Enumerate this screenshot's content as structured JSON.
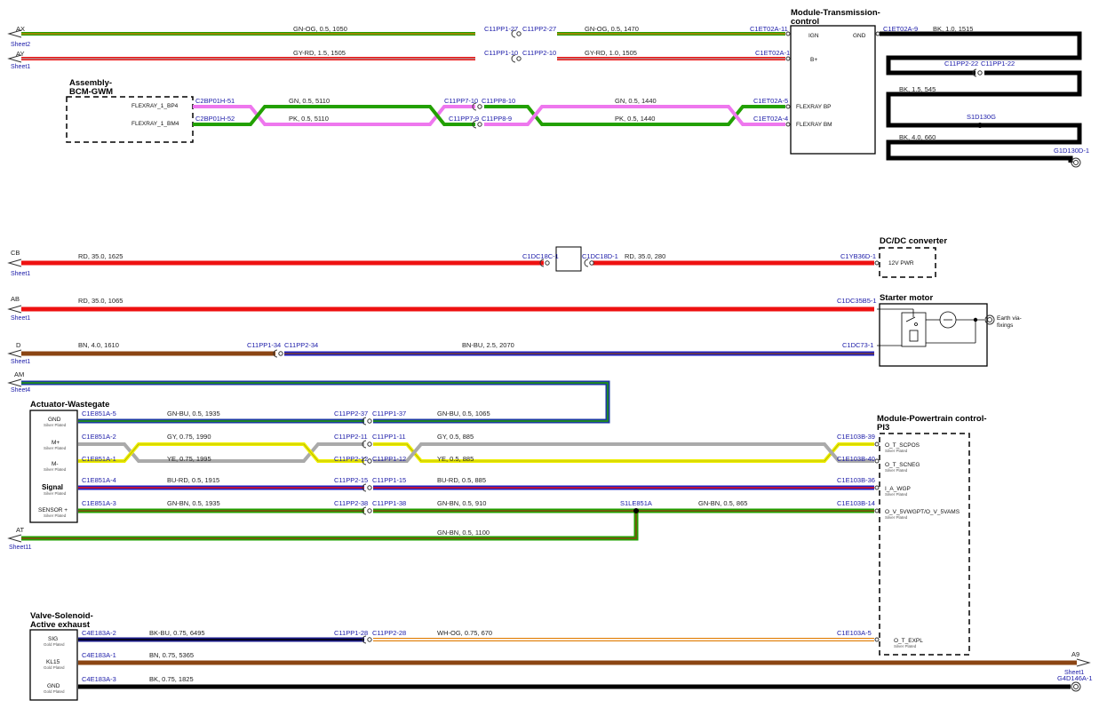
{
  "colors": {
    "gn": "#22a000",
    "og": "#e07a00",
    "rd": "#ee1111",
    "gy": "#aaaaaa",
    "pk": "#ee77ee",
    "bk": "#000000",
    "bn": "#8b4513",
    "bu": "#2020c0",
    "ye": "#eeee00",
    "wh": "#ffffff",
    "dk": "#111111",
    "conn_text": "#1a1aa8"
  },
  "top": {
    "ax": {
      "code": "AX",
      "sheet": "Sheet2",
      "w1": "GN-OG, 0.5, 1050",
      "c1": "C11PP1-27",
      "c2": "C11PP2-27",
      "w2": "GN-OG, 0.5, 1470",
      "c3": "C1ET02A-11"
    },
    "ay": {
      "code": "AY",
      "sheet": "Sheet1",
      "w1": "GY-RD, 1.5, 1505",
      "c1": "C11PP1-10",
      "c2": "C11PP2-10",
      "w2": "GY-RD, 1.0, 1505",
      "c3": "C1ET02A-1"
    },
    "bcm": {
      "title1": "Assembly-",
      "title2": "BCM-GWM",
      "pin1": "FLEXRAY_1_BP4",
      "pin2": "FLEXRAY_1_BM4",
      "c1": "C2BP01H-51",
      "c2": "C2BP01H-52"
    },
    "fr": {
      "w1": "GN, 0.5, 5110",
      "w2": "PK, 0.5, 5110",
      "c3": "C11PP7-10",
      "c4": "C11PP8-10",
      "c5": "C11PP7-9",
      "c6": "C11PP8-9",
      "w3": "GN, 0.5, 1440",
      "w4": "PK, 0.5, 1440",
      "c7": "C1ET02A-5",
      "c8": "C1ET02A-4"
    },
    "tcm": {
      "title1": "Module-Transmission-",
      "title2": "control",
      "ign": "IGN",
      "gnd": "GND",
      "bplus": "B+",
      "frbp": "FLEXRAY BP",
      "frbm": "FLEXRAY BM"
    },
    "gnd": {
      "c1": "C1ET02A-9",
      "w1": "BK, 1.0, 1515",
      "c2": "C11PP2-22",
      "c3": "C11PP1-22",
      "w2": "BK, 1.5, 545",
      "splice": "S1D130G",
      "w3": "BK, 4.0, 660",
      "ground": "G1D130D-1"
    }
  },
  "power": {
    "cb": {
      "code": "CB",
      "sheet": "Sheet1",
      "w1": "RD, 35.0, 1625",
      "c1": "C1DC18C-1",
      "c2": "C1DC18D-1",
      "w2": "RD, 35.0, 280",
      "c3": "C1YB36D-1"
    },
    "dcdc": {
      "title": "DC/DC converter",
      "pin": "12V PWR"
    },
    "ab": {
      "code": "AB",
      "sheet": "Sheet1",
      "w1": "RD, 35.0, 1065",
      "c1": "C1DC35B5-1"
    },
    "starter": {
      "title": "Starter motor",
      "earth1": "Earth via-",
      "earth2": "fixings"
    },
    "d": {
      "code": "D",
      "sheet": "Sheet1",
      "w1": "BN, 4.0, 1610",
      "c1": "C11PP1-34",
      "c2": "C11PP2-34",
      "w2": "BN-BU, 2.5, 2070",
      "c3": "C1DC73-1"
    }
  },
  "wastegate": {
    "am": {
      "code": "AM",
      "sheet": "Sheet4"
    },
    "title": "Actuator-Wastegate",
    "plating": "Silver Plated",
    "pins": [
      "GND",
      "M+",
      "M-",
      "Signal",
      "SENSOR +"
    ],
    "rows": [
      {
        "ca": "C1E851A-5",
        "w1": "GN-BU, 0.5, 1935",
        "cb": "C11PP2-37",
        "cc": "C11PP1-37",
        "w2": "GN-BU, 0.5, 1065"
      },
      {
        "ca": "C1E851A-2",
        "w1": "GY, 0.75, 1990",
        "cb": "C11PP2-11",
        "cc": "C11PP1-11",
        "w2": "GY, 0.5, 885",
        "cd": "C1E103B-39"
      },
      {
        "ca": "C1E851A-1",
        "w1": "YE, 0.75, 1995",
        "cb": "C11PP2-12",
        "cc": "C11PP1-12",
        "w2": "YE, 0.5, 885",
        "cd": "C1E103B-40"
      },
      {
        "ca": "C1E851A-4",
        "w1": "BU-RD, 0.5, 1915",
        "cb": "C11PP2-15",
        "cc": "C11PP1-15",
        "w2": "BU-RD, 0.5, 885",
        "cd": "C1E103B-36"
      },
      {
        "ca": "C1E851A-3",
        "w1": "GN-BN, 0.5, 1935",
        "cb": "C11PP2-38",
        "cc": "C11PP1-38",
        "w2": "GN-BN, 0.5, 910",
        "splice": "S1LE851A",
        "w3": "GN-BN, 0.5, 865",
        "cd": "C1E103B-14"
      }
    ],
    "at": {
      "code": "AT",
      "sheet": "Sheet11",
      "w1": "GN-BN, 0.5, 1100"
    }
  },
  "pcm": {
    "title1": "Module-Powertrain control-",
    "title2": "PI3",
    "plating": "Silver Plated",
    "pins": [
      "O_T_SCPOS",
      "O_T_SCNEG",
      "I_A_WGP",
      "O_V_5VWGPT/O_V_5VAMS",
      "O_T_EXPL"
    ]
  },
  "valve": {
    "title1": "Valve-Solenoid-",
    "title2": "Active exhaust",
    "plating": "Gold Plated",
    "pins": [
      "SIG",
      "KL15",
      "GND"
    ],
    "rows": [
      {
        "ca": "C4E183A-2",
        "w1": "BK-BU, 0.75, 6495",
        "cb": "C11PP1-28",
        "cc": "C11PP2-28",
        "w2": "WH-OG, 0.75, 670",
        "cd": "C1E103A-5"
      },
      {
        "ca": "C4E183A-1",
        "w1": "BN, 0.75, 5365",
        "code": "A9",
        "sheet": "Sheet1"
      },
      {
        "ca": "C4E183A-3",
        "w1": "BK, 0.75, 1825",
        "ground": "G4D146A-1"
      }
    ]
  }
}
